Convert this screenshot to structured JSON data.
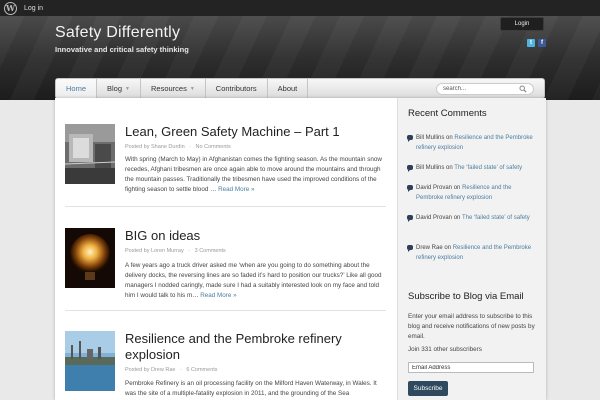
{
  "admin_bar": {
    "login_label": "Log in"
  },
  "header": {
    "site_title": "Safety Differently",
    "tagline": "Innovative and critical safety thinking",
    "login_button": "Login",
    "social": {
      "twitter_glyph": "t",
      "facebook_glyph": "f"
    }
  },
  "nav": {
    "items": [
      {
        "label": "Home",
        "has_dropdown": false
      },
      {
        "label": "Blog",
        "has_dropdown": true
      },
      {
        "label": "Resources",
        "has_dropdown": true
      },
      {
        "label": "Contributors",
        "has_dropdown": false
      },
      {
        "label": "About",
        "has_dropdown": false
      }
    ],
    "search_placeholder": "search..."
  },
  "posts": [
    {
      "title": "Lean, Green Safety Machine – Part 1",
      "posted_by_label": "Posted by",
      "author": "Shane Durdin",
      "comments": "No Comments",
      "excerpt": "With spring (March to May) in Afghanistan comes the fighting season. As the mountain snow recedes, Afghani tribesmen are once again able to move around the mountains and through the mountain passes. Traditionally the tribesmen have used the improved conditions of the fighting season to settle blood …",
      "read_more": "Read More »"
    },
    {
      "title": "BIG on ideas",
      "posted_by_label": "Posted by",
      "author": "Loren Murray",
      "comments": "3 Comments",
      "excerpt": "A few years ago a truck driver asked me ‘when are you going to do something about the delivery docks, the reversing lines are so faded it’s hard to position our trucks?’ Like all good managers I nodded caringly, made sure I had a suitably interested look on my face and told him I would talk to his m…",
      "read_more": "Read More »"
    },
    {
      "title": "Resilience and the Pembroke refinery explosion",
      "posted_by_label": "Posted by",
      "author": "Drew Rae",
      "comments": "6 Comments",
      "excerpt": "Pembroke Refinery is an oil processing facility on the Milford Haven Waterway, in Wales. It was the site of a multiple-fatality explosion in 2011, and the grounding of the Sea"
    }
  ],
  "sidebar": {
    "recent_comments_title": "Recent Comments",
    "recent_comments": [
      {
        "author": "Bill Mullins",
        "on": "on",
        "post": "Resilience and the Pembroke refinery explosion"
      },
      {
        "author": "Bill Mullins",
        "on": "on",
        "post": "The ‘failed state’ of safety"
      },
      {
        "author": "David Provan",
        "on": "on",
        "post": "Resilience and the Pembroke refinery explosion"
      },
      {
        "author": "David Provan",
        "on": "on",
        "post": "The ‘failed state’ of safety"
      },
      {
        "author": "Drew Rae",
        "on": "on",
        "post": "Resilience and the Pembroke refinery explosion"
      }
    ],
    "subscribe_title": "Subscribe to Blog via Email",
    "subscribe_text": "Enter your email address to subscribe to this blog and receive notifications of new posts by email.",
    "subscribers": "Join 331 other subscribers",
    "email_placeholder": "Email Address",
    "subscribe_button": "Subscribe"
  },
  "colors": {
    "link": "#4d7da0",
    "header_dark": "#1c1c1c",
    "button_dark": "#2f4a5e"
  }
}
